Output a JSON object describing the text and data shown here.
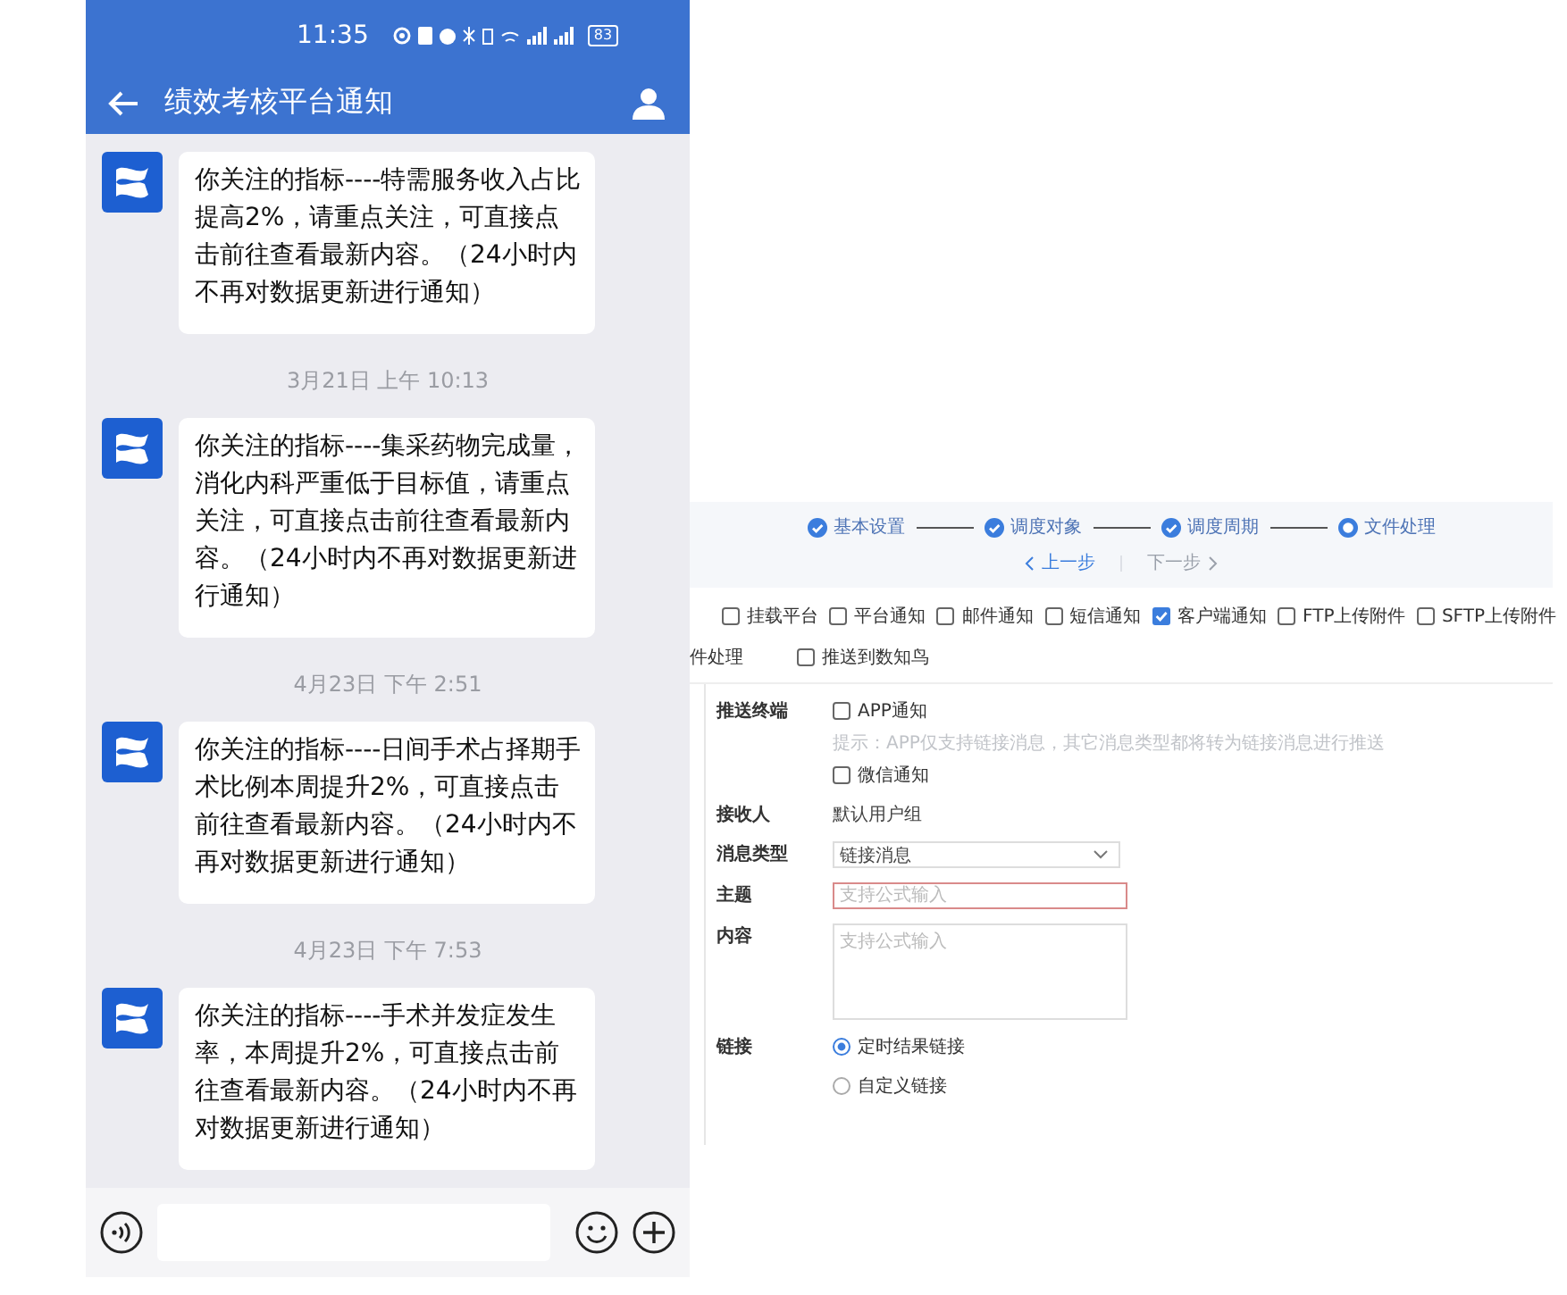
{
  "status_bar": {
    "time": "11:35",
    "battery": "83"
  },
  "header": {
    "title": "绩效考核平台通知"
  },
  "chat": [
    {
      "kind": "message",
      "text": "你关注的指标----特需服务收入占比提高2%，请重点关注，可直接点击前往查看最新内容。（24小时内不再对数据更新进行通知）"
    },
    {
      "kind": "time",
      "text": "3月21日  上午 10:13"
    },
    {
      "kind": "message",
      "text": "你关注的指标----集采药物完成量，消化内科严重低于目标值，请重点关注，可直接点击前往查看最新内容。（24小时内不再对数据更新进行通知）"
    },
    {
      "kind": "time",
      "text": "4月23日  下午 2:51"
    },
    {
      "kind": "message",
      "text": "你关注的指标----日间手术占择期手术比例本周提升2%，可直接点击前往查看最新内容。（24小时内不再对数据更新进行通知）"
    },
    {
      "kind": "time",
      "text": "4月23日  下午 7:53"
    },
    {
      "kind": "message",
      "text": "你关注的指标----手术并发症发生率，本周提升2%，可直接点击前往查看最新内容。（24小时内不再对数据更新进行通知）"
    }
  ],
  "steps": [
    {
      "label": "基本设置",
      "done": true
    },
    {
      "label": "调度对象",
      "done": true
    },
    {
      "label": "调度周期",
      "done": true
    },
    {
      "label": "文件处理",
      "done": false
    }
  ],
  "step_nav": {
    "prev": "上一步",
    "next": "下一步",
    "next_disabled": true
  },
  "channels": [
    {
      "label": "挂载平台",
      "checked": false
    },
    {
      "label": "平台通知",
      "checked": false
    },
    {
      "label": "邮件通知",
      "checked": false
    },
    {
      "label": "短信通知",
      "checked": false
    },
    {
      "label": "客户端通知",
      "checked": true
    },
    {
      "label": "FTP上传附件",
      "checked": false
    },
    {
      "label": "SFTP上传附件",
      "checked": false
    }
  ],
  "channels_row2": {
    "cut_label": "件处理",
    "items": [
      {
        "label": "推送到数知鸟",
        "checked": false
      }
    ]
  },
  "form": [
    {
      "kind": "checks",
      "label": "推送终端",
      "options": [
        {
          "label": "APP通知",
          "checked": false,
          "hint": "提示：APP仅支持链接消息，其它消息类型都将转为链接消息进行推送"
        },
        {
          "label": "微信通知",
          "checked": false
        }
      ]
    },
    {
      "kind": "text",
      "label": "接收人",
      "value": "默认用户组"
    },
    {
      "kind": "select",
      "label": "消息类型",
      "value": "链接消息"
    },
    {
      "kind": "input",
      "label": "主题",
      "placeholder": "支持公式输入",
      "invalid": true
    },
    {
      "kind": "textarea",
      "label": "内容",
      "placeholder": "支持公式输入"
    },
    {
      "kind": "radios",
      "label": "链接",
      "options": [
        {
          "label": "定时结果链接",
          "selected": true
        },
        {
          "label": "自定义链接",
          "selected": false
        }
      ]
    }
  ]
}
